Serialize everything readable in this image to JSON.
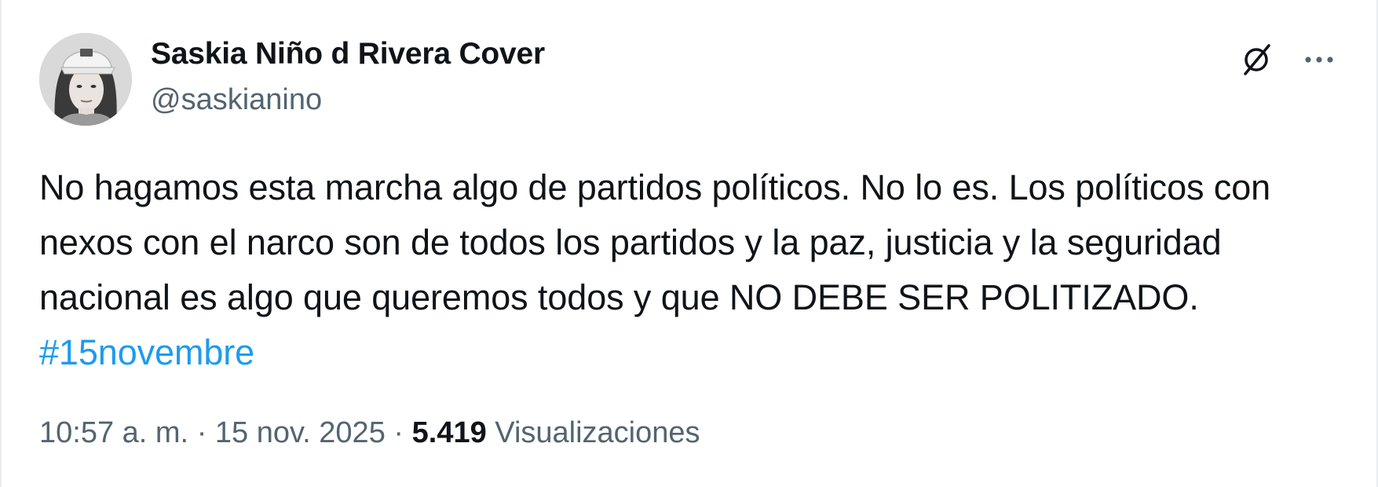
{
  "author": {
    "display_name": "Saskia Niño d Rivera Cover",
    "handle": "@saskianino"
  },
  "tweet": {
    "text": "No hagamos esta marcha algo de partidos políticos. No lo es. Los políticos con nexos con el narco son de todos los partidos y la paz, justicia y la seguridad nacional es algo que queremos todos y que NO DEBE SER POLITIZADO.",
    "hashtag": "#15novembre"
  },
  "meta": {
    "time": "10:57 a. m.",
    "separator": "·",
    "date": "15 nov. 2025",
    "views_count": "5.419",
    "views_label": "Visualizaciones"
  },
  "icons": {
    "grok": "grok-slash-circle-icon",
    "more": "more-horizontal-icon"
  },
  "colors": {
    "text_primary": "#0f1419",
    "text_secondary": "#536471",
    "link": "#1d9bf0"
  }
}
